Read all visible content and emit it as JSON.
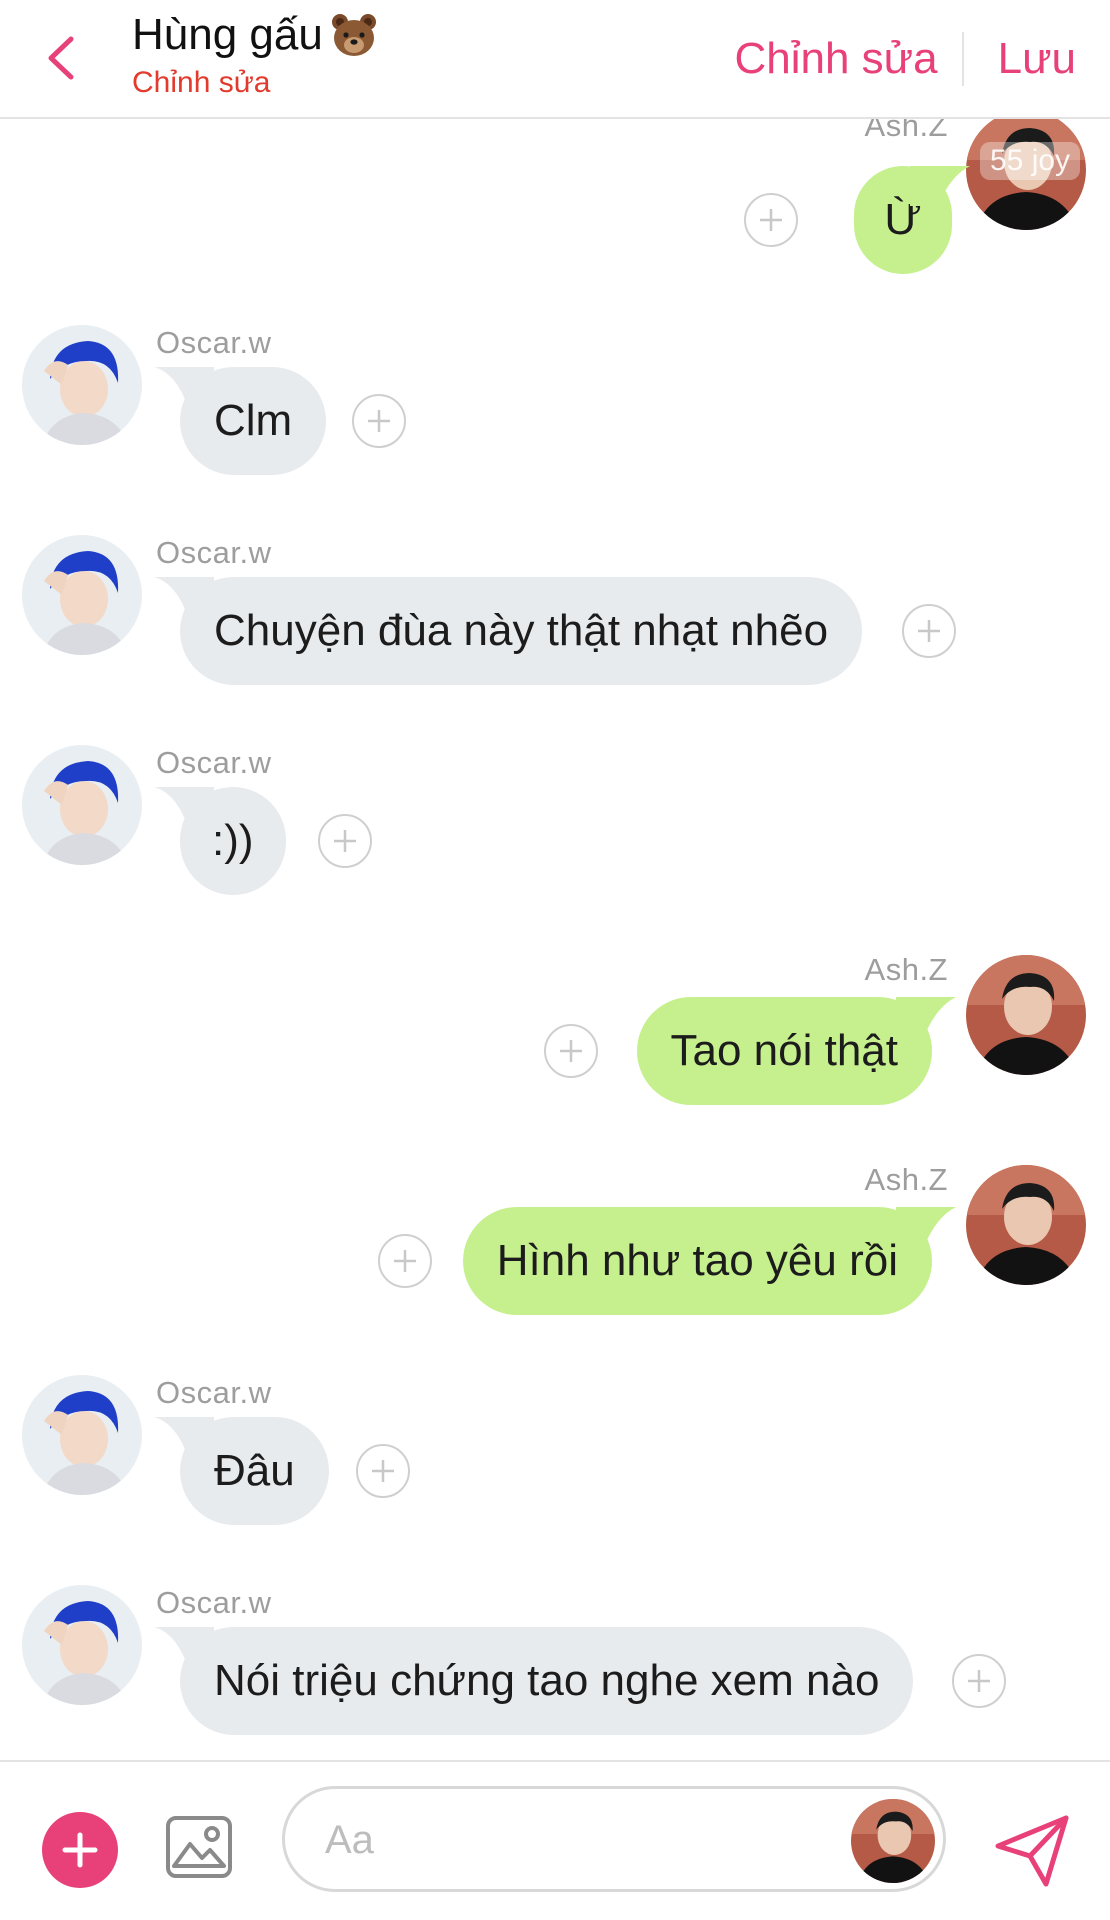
{
  "header": {
    "title": "Hùng gấu",
    "title_emoji": "bear-face-emoji",
    "subtitle": "Chỉnh sửa",
    "edit_label": "Chỉnh sửa",
    "save_label": "Lưu",
    "accent_color": "#e8417a"
  },
  "watermark": "55 joy",
  "messages": [
    {
      "side": "outgoing",
      "sender": "Ash.Z",
      "text": "Ừ"
    },
    {
      "side": "incoming",
      "sender": "Oscar.w",
      "text": "Clm"
    },
    {
      "side": "incoming",
      "sender": "Oscar.w",
      "text": "Chuyện đùa này thật nhạt nhẽo"
    },
    {
      "side": "incoming",
      "sender": "Oscar.w",
      "text": ":))"
    },
    {
      "side": "outgoing",
      "sender": "Ash.Z",
      "text": "Tao nói thật"
    },
    {
      "side": "outgoing",
      "sender": "Ash.Z",
      "text": "Hình như tao yêu rồi"
    },
    {
      "side": "incoming",
      "sender": "Oscar.w",
      "text": "Đâu"
    },
    {
      "side": "incoming",
      "sender": "Oscar.w",
      "text": "Nói triệu chứng tao nghe xem nào"
    }
  ],
  "composer": {
    "placeholder": "Aa",
    "add_icon": "plus-icon",
    "image_icon": "image-icon",
    "send_icon": "send-icon"
  },
  "colors": {
    "incoming_bubble": "#e8ebee",
    "outgoing_bubble": "#c6f08d",
    "subtitle": "#e23a2c"
  }
}
